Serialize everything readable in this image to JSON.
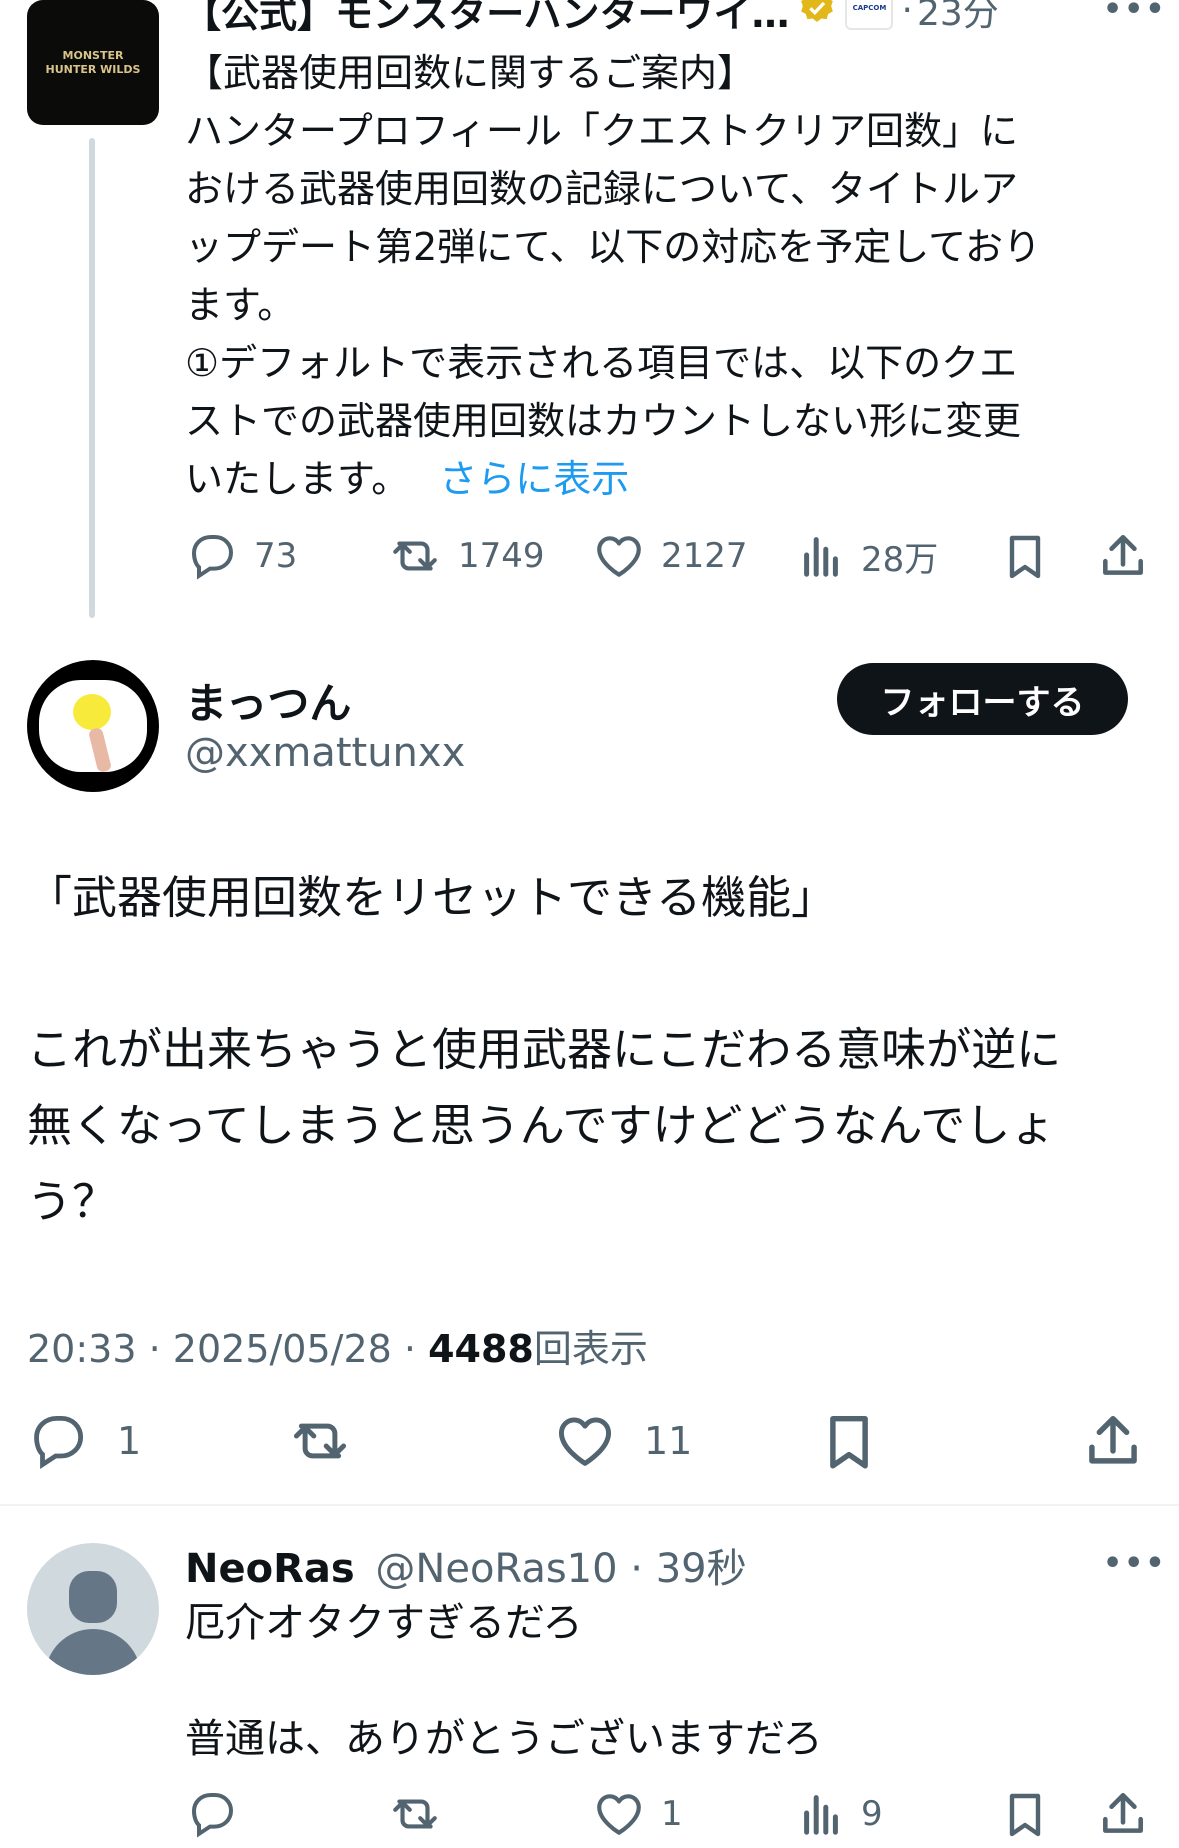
{
  "quoted_tweet": {
    "author_name": "【公式】モンスターハンターワイ…",
    "separator": "·",
    "time": "23分",
    "avatar_text": "MONSTER HUNTER WILDS",
    "affiliate_badge_text": "CAPCOM",
    "body_lines": [
      "【武器使用回数に関するご案内】",
      "ハンタープロフィール「クエストクリア回数」に",
      "おける武器使用回数の記録について、タイトルア",
      "ップデート第2弾にて、以下の対応を予定しており",
      "ます。",
      "①デフォルトで表示される項目では、以下のクエ",
      "ストでの武器使用回数はカウントしない形に変更"
    ],
    "last_line": "いたします。",
    "show_more": "さらに表示",
    "replies": "73",
    "retweets": "1749",
    "likes": "2127",
    "views": "28万"
  },
  "main_tweet": {
    "author_name": "まっつん",
    "handle": "@xxmattunxx",
    "follow_label": "フォローする",
    "line1": "「武器使用回数をリセットできる機能」",
    "line2": "これが出来ちゃうと使用武器にこだわる意味が逆に",
    "line3": "無くなってしまうと思うんですけどどうなんでしょ",
    "line4": "う？",
    "time": "20:33",
    "date": "2025/05/28",
    "sep": "·",
    "views_count": "4488",
    "views_label": "回表示",
    "replies": "1",
    "likes": "11"
  },
  "reply_tweet": {
    "author_name": "NeoRas",
    "handle": "@NeoRas10",
    "sep": "·",
    "time": "39秒",
    "line1": "厄介オタクすぎるだろ",
    "line2": "普通は、ありがとうございますだろ",
    "likes": "1",
    "views": "9"
  },
  "colors": {
    "accent": "#1d9bf0",
    "gray": "#536471",
    "verified_gold": "#e2b719"
  }
}
